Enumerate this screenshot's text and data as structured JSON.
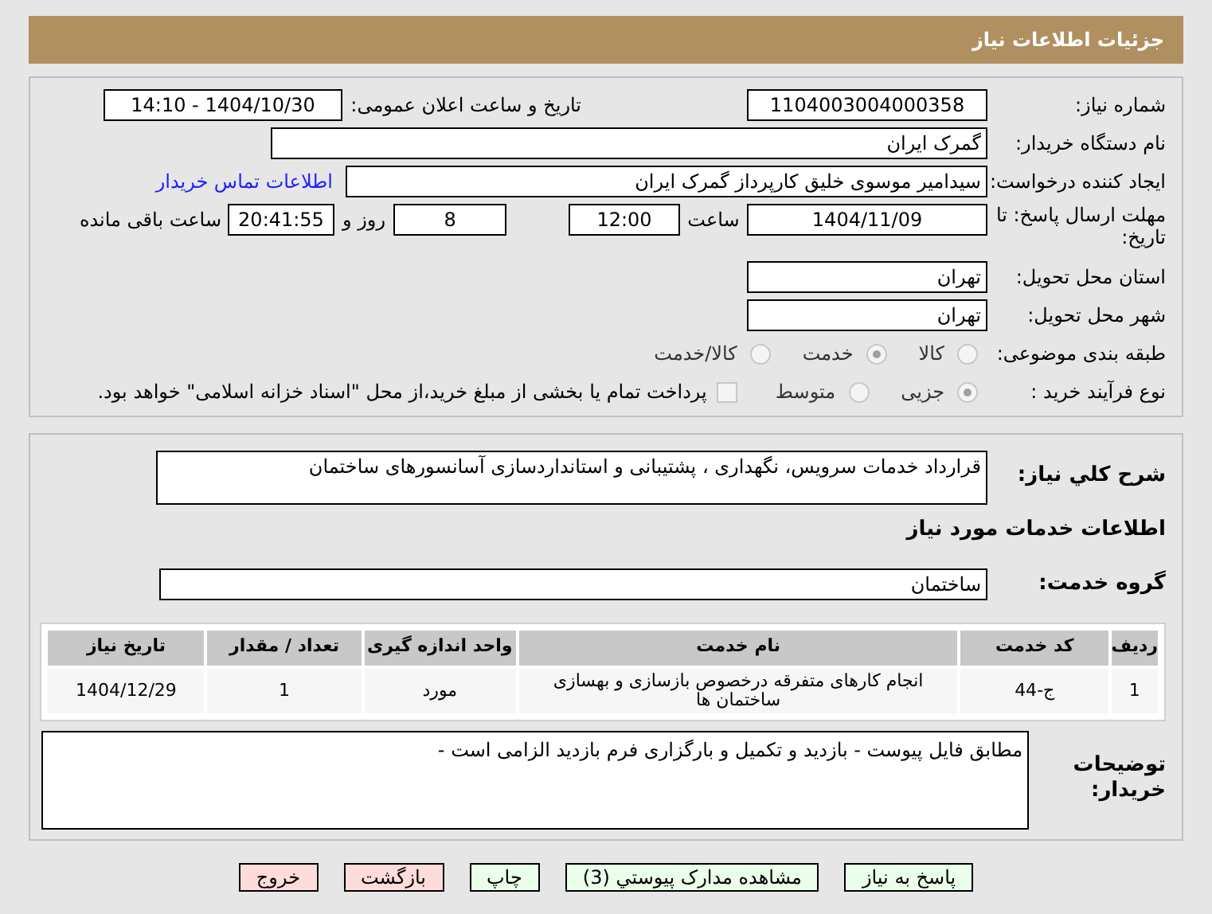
{
  "header": {
    "title": "جزئیات اطلاعات نیاز"
  },
  "need_number": {
    "label": "شماره نیاز:",
    "value": "1104003004000358"
  },
  "announce": {
    "label": "تاریخ و ساعت اعلان عمومی:",
    "value": "1404/10/30 - 14:10"
  },
  "buyer": {
    "label": "نام دستگاه خریدار:",
    "value": "گمرک ایران"
  },
  "creator": {
    "label": "ایجاد کننده درخواست:",
    "value": "سیدامیر موسوی خلیق کارپرداز گمرک ایران",
    "link": "اطلاعات تماس خریدار"
  },
  "deadline": {
    "label": "مهلت ارسال پاسخ: تا تاریخ:",
    "date": "1404/11/09",
    "time_label": "ساعت",
    "time": "12:00",
    "days": "8",
    "days_label": "روز و",
    "remaining": "20:41:55",
    "remaining_label": "ساعت باقی مانده"
  },
  "province": {
    "label": "استان محل تحویل:",
    "value": "تهران"
  },
  "city": {
    "label": "شهر محل تحویل:",
    "value": "تهران"
  },
  "category": {
    "label": "طبقه بندی موضوعی:",
    "options": [
      {
        "label": "کالا",
        "selected": false
      },
      {
        "label": "خدمت",
        "selected": true
      },
      {
        "label": "کالا/خدمت",
        "selected": false
      }
    ]
  },
  "process": {
    "label": "نوع فرآیند خرید :",
    "options": [
      {
        "label": "جزیی",
        "selected": true
      },
      {
        "label": "متوسط",
        "selected": false
      }
    ],
    "payment": {
      "checked": false,
      "label": "پرداخت تمام یا بخشی از مبلغ خرید،از محل \"اسناد خزانه اسلامی\" خواهد بود."
    }
  },
  "description": {
    "label": "شرح کلي نياز:",
    "value": "قرارداد خدمات سرویس، نگهداری ، پشتیبانی و استانداردسازی آسانسورهای ساختمان"
  },
  "services_heading": "اطلاعات خدمات مورد نیاز",
  "service_group": {
    "label": "گروه خدمت:",
    "value": "ساختمان"
  },
  "table": {
    "columns": [
      "ردیف",
      "کد خدمت",
      "نام خدمت",
      "واحد اندازه گیری",
      "تعداد / مقدار",
      "تاریخ نیاز"
    ],
    "rows": [
      [
        "1",
        "ج-44",
        "انجام کارهای متفرقه درخصوص بازسازی و بهسازی ساختمان ها",
        "مورد",
        "1",
        "1404/12/29"
      ]
    ]
  },
  "notes": {
    "label": "توضیحات خریدار:",
    "value": "مطابق فایل پیوست - بازدید و تکمیل و بارگزاری فرم بازدید الزامی است -"
  },
  "buttons": [
    {
      "label": "پاسخ به نیاز",
      "kind": "action"
    },
    {
      "label": "مشاهده مدارک پیوستي (3)",
      "kind": "action"
    },
    {
      "label": "چاپ",
      "kind": "action"
    },
    {
      "label": "بازگشت",
      "kind": "exit"
    },
    {
      "label": "خروج",
      "kind": "exit"
    }
  ]
}
